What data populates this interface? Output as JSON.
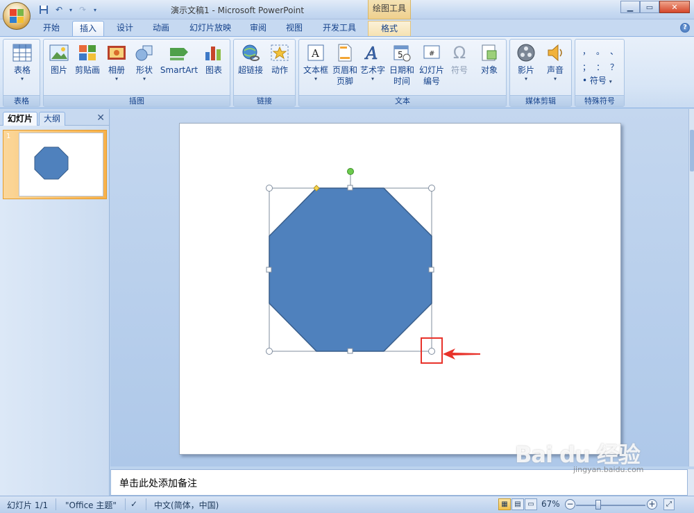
{
  "titlebar": {
    "title": "演示文稿1 - Microsoft PowerPoint",
    "context_tab_title": "绘图工具"
  },
  "tabs": [
    "开始",
    "插入",
    "设计",
    "动画",
    "幻灯片放映",
    "审阅",
    "视图",
    "开发工具",
    "格式"
  ],
  "active_tab": "插入",
  "ribbon": {
    "groups": {
      "table": {
        "label": "表格",
        "buttons": [
          "表格"
        ]
      },
      "illustrations": {
        "label": "插图",
        "buttons": [
          "图片",
          "剪贴画",
          "相册",
          "形状",
          "SmartArt",
          "图表"
        ]
      },
      "links": {
        "label": "链接",
        "buttons": [
          "超链接",
          "动作"
        ]
      },
      "text": {
        "label": "文本",
        "buttons": [
          "文本框",
          "页眉和\n页脚",
          "艺术字",
          "日期和\n时间",
          "幻灯片\n编号",
          "符号",
          "对象"
        ]
      },
      "media": {
        "label": "媒体剪辑",
        "buttons": [
          "影片",
          "声音"
        ]
      },
      "special": {
        "label": "特殊符号",
        "buttons": [
          "符号"
        ],
        "glyphs": [
          "，",
          "。",
          "、",
          "；",
          "：",
          "？"
        ]
      }
    }
  },
  "leftpanel": {
    "tab_slides": "幻灯片",
    "tab_outline": "大纲",
    "slide_number": "1"
  },
  "notes": {
    "placeholder": "单击此处添加备注"
  },
  "statusbar": {
    "slide_info": "幻灯片 1/1",
    "theme": "\"Office 主题\"",
    "language": "中文(简体，中国)",
    "zoom": "67%"
  },
  "watermark": {
    "text": "Bai du 经验",
    "sub": "jingyan.baidu.com"
  },
  "colors": {
    "shape_fill": "#4f81bd",
    "shape_border": "#385d8a",
    "highlight": "#e8322a"
  }
}
